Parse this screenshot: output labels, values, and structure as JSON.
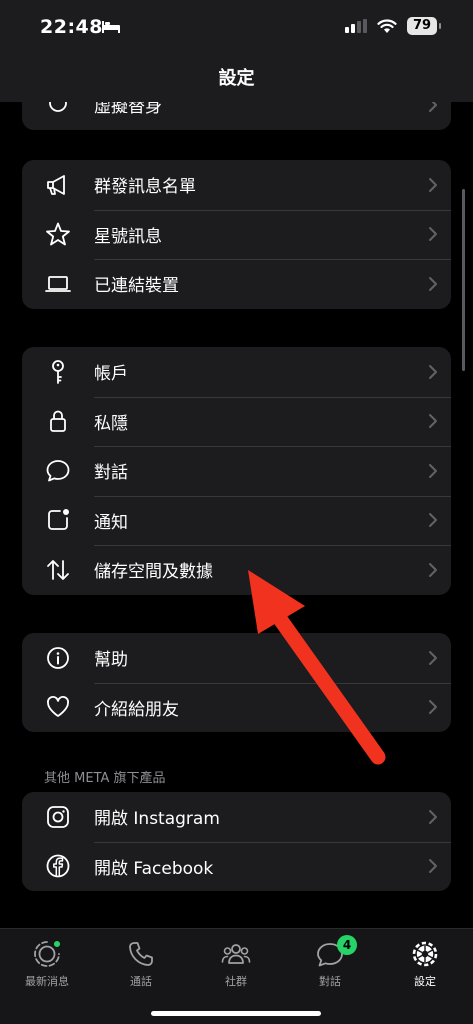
{
  "status": {
    "time": "22:48",
    "battery": "79"
  },
  "header": {
    "title": "設定"
  },
  "groups": {
    "partial": {
      "label": "虛擬替身"
    },
    "g1": [
      {
        "label": "群發訊息名單",
        "icon": "megaphone-icon"
      },
      {
        "label": "星號訊息",
        "icon": "star-icon"
      },
      {
        "label": "已連結裝置",
        "icon": "laptop-icon"
      }
    ],
    "g2": [
      {
        "label": "帳戶",
        "icon": "key-icon"
      },
      {
        "label": "私隱",
        "icon": "lock-icon"
      },
      {
        "label": "對話",
        "icon": "chat-bubble-icon"
      },
      {
        "label": "通知",
        "icon": "notification-icon"
      },
      {
        "label": "儲存空間及數據",
        "icon": "up-down-arrows-icon"
      }
    ],
    "g3": [
      {
        "label": "幫助",
        "icon": "info-icon"
      },
      {
        "label": "介紹給朋友",
        "icon": "heart-icon"
      }
    ],
    "meta_header": "其他 META 旗下產品",
    "g4": [
      {
        "label": "開啟 Instagram",
        "icon": "instagram-icon"
      },
      {
        "label": "開啟 Facebook",
        "icon": "facebook-icon"
      }
    ]
  },
  "tabs": [
    {
      "label": "最新消息",
      "icon": "updates-icon"
    },
    {
      "label": "通話",
      "icon": "phone-icon"
    },
    {
      "label": "社群",
      "icon": "community-icon"
    },
    {
      "label": "對話",
      "icon": "chats-icon",
      "badge": "4"
    },
    {
      "label": "設定",
      "icon": "settings-icon",
      "active": true
    }
  ],
  "colors": {
    "accent": "#25d366",
    "arrow": "#f0321e",
    "background": "#000000",
    "card": "#1c1c1e"
  }
}
